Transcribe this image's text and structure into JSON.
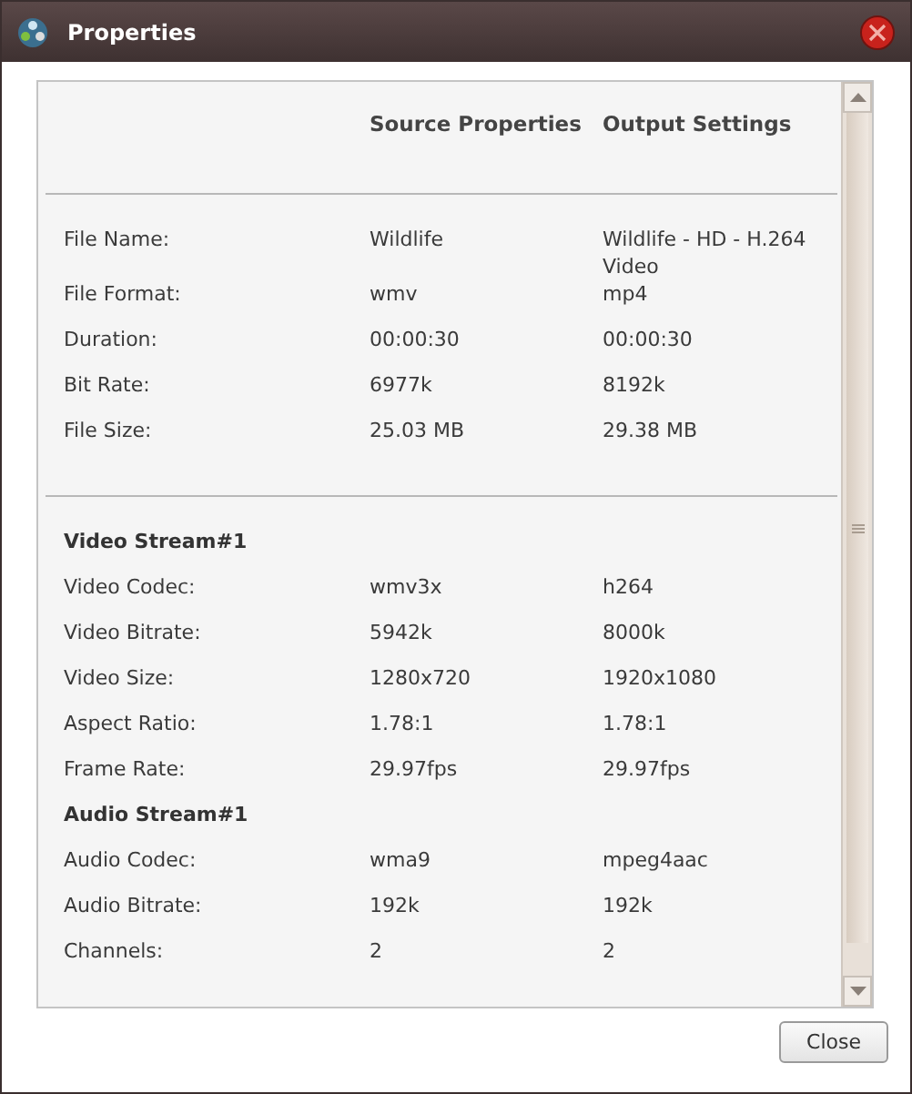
{
  "window": {
    "title": "Properties"
  },
  "columns": [
    "Source Properties",
    "Output Settings"
  ],
  "sections": [
    {
      "rows": [
        {
          "kind": "property",
          "label": "File Name:",
          "source": "Wildlife",
          "output": "Wildlife - HD - H.264 Video"
        },
        {
          "kind": "property",
          "label": "File Format:",
          "source": "wmv",
          "output": "mp4"
        },
        {
          "kind": "property",
          "label": "Duration:",
          "source": "00:00:30",
          "output": "00:00:30"
        },
        {
          "kind": "property",
          "label": "Bit Rate:",
          "source": "6977k",
          "output": "8192k"
        },
        {
          "kind": "property",
          "label": "File Size:",
          "source": "25.03 MB",
          "output": "29.38 MB"
        }
      ]
    },
    {
      "rows": [
        {
          "kind": "heading",
          "label": "Video Stream#1"
        },
        {
          "kind": "property",
          "label": "Video Codec:",
          "source": "wmv3x",
          "output": "h264"
        },
        {
          "kind": "property",
          "label": "Video Bitrate:",
          "source": "5942k",
          "output": "8000k"
        },
        {
          "kind": "property",
          "label": "Video Size:",
          "source": "1280x720",
          "output": "1920x1080"
        },
        {
          "kind": "property",
          "label": "Aspect Ratio:",
          "source": "1.78:1",
          "output": "1.78:1"
        },
        {
          "kind": "property",
          "label": "Frame Rate:",
          "source": "29.97fps",
          "output": "29.97fps"
        },
        {
          "kind": "heading",
          "label": "Audio Stream#1"
        },
        {
          "kind": "property",
          "label": "Audio Codec:",
          "source": "wma9",
          "output": "mpeg4aac"
        },
        {
          "kind": "property",
          "label": "Audio Bitrate:",
          "source": "192k",
          "output": "192k"
        },
        {
          "kind": "property",
          "label": "Channels:",
          "source": "2",
          "output": "2"
        }
      ]
    }
  ],
  "buttons": [
    "Close"
  ]
}
